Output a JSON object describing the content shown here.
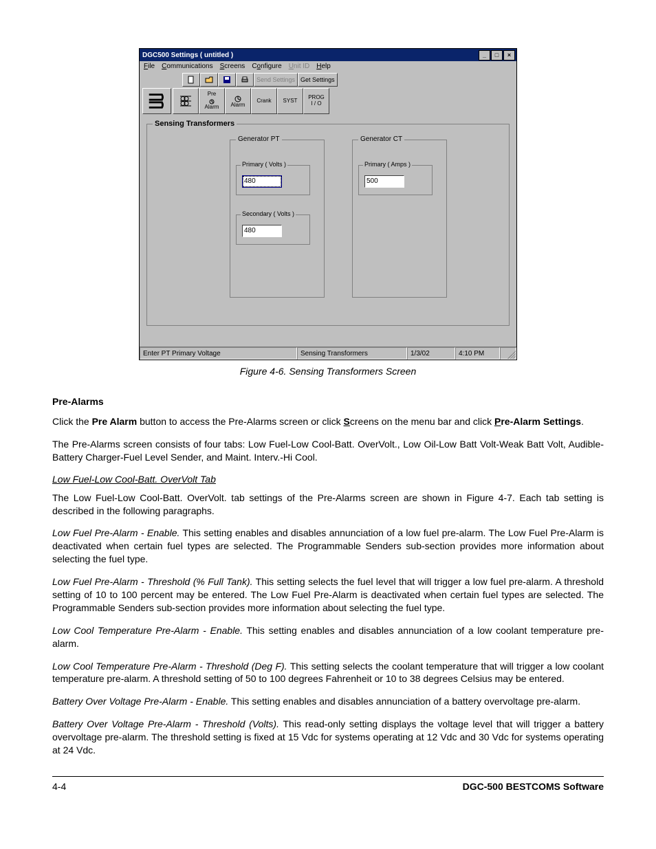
{
  "screenshot": {
    "title": "DGC500 Settings   ( untitled )",
    "menu": {
      "file": "File",
      "communications": "Communications",
      "screens": "Screens",
      "configure": "Configure",
      "unitid": "Unit ID",
      "help": "Help"
    },
    "toolbar": {
      "sendSettings": "Send Settings",
      "getSettings": "Get Settings"
    },
    "progButtons": {
      "prealarm_top": "Pre",
      "prealarm_bot": "Alarm",
      "alarm": "Alarm",
      "crank": "Crank",
      "syst": "SYST",
      "prog_top": "PROG",
      "prog_bot": "I / O"
    },
    "mainGroup": "Sensing Transformers",
    "pt": {
      "legend": "Generator PT",
      "primary": {
        "legend": "Primary ( Volts )",
        "value": "480"
      },
      "secondary": {
        "legend": "Secondary ( Volts )",
        "value": "480"
      }
    },
    "ct": {
      "legend": "Generator CT",
      "primary": {
        "legend": "Primary ( Amps )",
        "value": "500"
      }
    },
    "status": {
      "hint": "Enter PT Primary Voltage",
      "panel": "Sensing Transformers",
      "date": "1/3/02",
      "time": "4:10 PM"
    }
  },
  "caption": "Figure 4-6. Sensing Transformers Screen",
  "h_prealarms": "Pre-Alarms",
  "p1a": "Click the ",
  "p1b": "Pre Alarm",
  "p1c": " button to access the Pre-Alarms screen or click ",
  "p1d": "S",
  "p1e": "creens on the menu bar and click ",
  "p1f": "P",
  "p1g": "re-Alarm Settings",
  "p1h": ".",
  "p2": "The Pre-Alarms screen consists of four tabs: Low Fuel-Low Cool-Batt. OverVolt., Low Oil-Low Batt Volt-Weak Batt Volt, Audible-Battery Charger-Fuel Level Sender, and Maint. Interv.-Hi Cool.",
  "sub1": "Low Fuel-Low Cool-Batt. OverVolt Tab",
  "p3": "The Low Fuel-Low Cool-Batt. OverVolt. tab settings of the Pre-Alarms screen are shown in Figure 4-7. Each tab setting is described in the following paragraphs.",
  "r1a": "Low Fuel Pre-Alarm - Enable.",
  "r1b": " This setting enables and disables annunciation of a low fuel pre-alarm. The Low Fuel Pre-Alarm is deactivated when certain fuel types are selected. The Programmable Senders sub-section provides more information about selecting the fuel type.",
  "r2a": "Low Fuel Pre-Alarm - Threshold (% Full Tank).",
  "r2b": " This setting selects the fuel level that will trigger a low fuel pre-alarm. A threshold setting of 10 to 100 percent may be entered. The Low Fuel Pre-Alarm is deactivated when certain fuel types are selected. The Programmable Senders sub-section provides more information about selecting the fuel type.",
  "r3a": "Low Cool Temperature Pre-Alarm - Enable.",
  "r3b": " This setting enables and disables annunciation of a low coolant temperature pre-alarm.",
  "r4a": "Low Cool Temperature Pre-Alarm - Threshold (Deg F).",
  "r4b": " This setting selects the coolant temperature that will trigger a low coolant temperature pre-alarm. A threshold setting of 50 to 100 degrees Fahrenheit or 10 to 38 degrees Celsius may be entered.",
  "r5a": "Battery Over Voltage Pre-Alarm - Enable.",
  "r5b": " This setting enables and disables annunciation of a battery overvoltage pre-alarm.",
  "r6a": "Battery Over Voltage Pre-Alarm - Threshold (Volts).",
  "r6b": " This read-only setting displays the voltage level that will trigger a battery overvoltage pre-alarm. The threshold setting is fixed at 15 Vdc for systems operating at 12 Vdc and 30 Vdc for systems operating at 24 Vdc.",
  "footer": {
    "page": "4-4",
    "product": "DGC-500 BESTCOMS Software"
  }
}
